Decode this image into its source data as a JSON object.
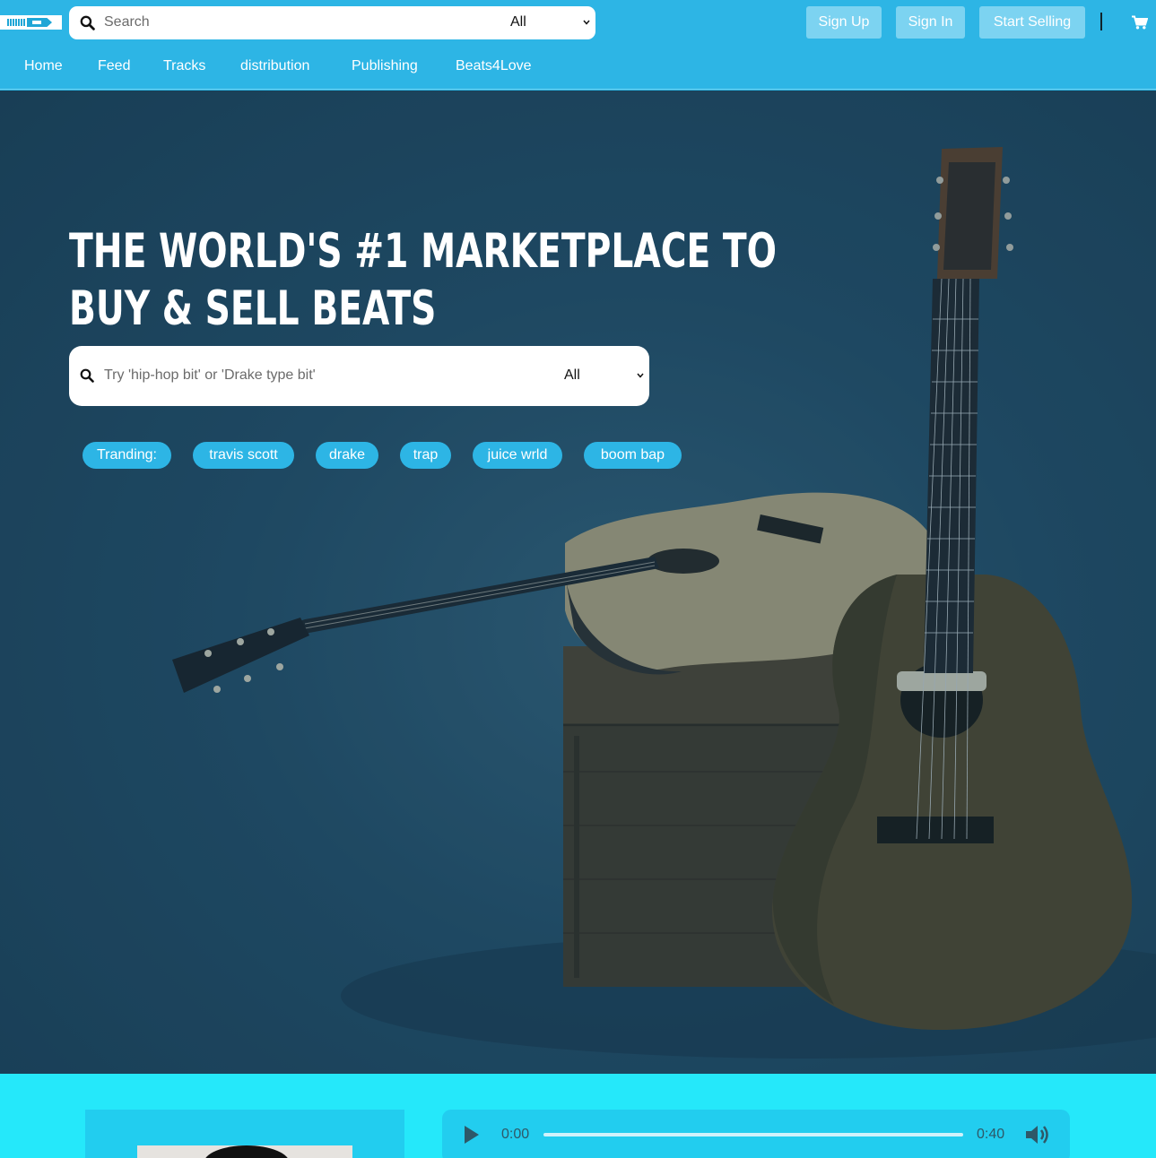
{
  "header": {
    "logo_name": "site-logo",
    "search": {
      "placeholder": "Search",
      "category": "All"
    },
    "buttons": {
      "sign_up": "Sign Up",
      "sign_in": "Sign In",
      "start_selling": "Start Selling"
    },
    "divider": "|",
    "cart_icon": "cart-icon"
  },
  "nav": {
    "items": [
      {
        "label": "Home"
      },
      {
        "label": "Feed"
      },
      {
        "label": "Tracks"
      },
      {
        "label": "distribution"
      },
      {
        "label": "Publishing"
      },
      {
        "label": "Beats4Love"
      }
    ]
  },
  "hero": {
    "headline_line1": "THE WORLD'S #1 MARKETPLACE TO",
    "headline_line2": "BUY & SELL BEATS",
    "search": {
      "placeholder": "Try 'hip-hop bit' or 'Drake type bit'",
      "category": "All"
    },
    "trending_label": "Tranding:",
    "trending_tags": [
      "travis scott",
      "drake",
      "trap",
      "juice wrld",
      "boom bap"
    ]
  },
  "player": {
    "current_time": "0:00",
    "duration": "0:40",
    "progress": 0
  },
  "colors": {
    "brand_blue": "#2db5e5",
    "hero_bg": "#1f4760",
    "bottom_bg": "#25e8fa"
  }
}
